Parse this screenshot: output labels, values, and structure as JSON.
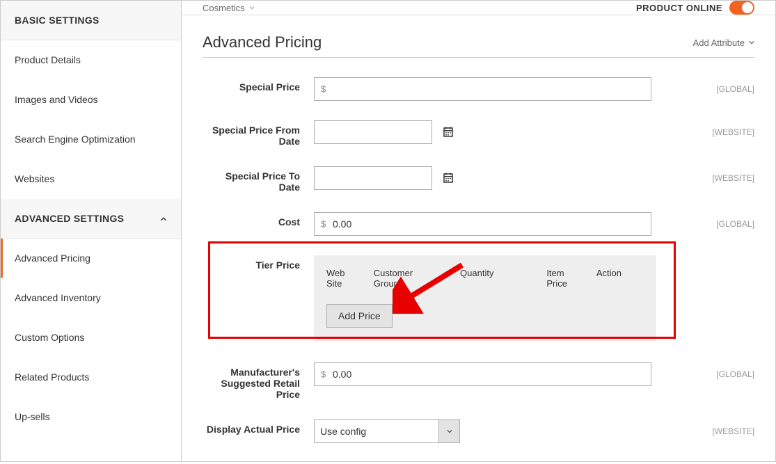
{
  "sidebar": {
    "basic_heading": "BASIC SETTINGS",
    "adv_heading": "ADVANCED SETTINGS",
    "items_basic": [
      {
        "label": "Product Details"
      },
      {
        "label": "Images and Videos"
      },
      {
        "label": "Search Engine Optimization"
      },
      {
        "label": "Websites"
      }
    ],
    "items_adv": [
      {
        "label": "Advanced Pricing"
      },
      {
        "label": "Advanced Inventory"
      },
      {
        "label": "Custom Options"
      },
      {
        "label": "Related Products"
      },
      {
        "label": "Up-sells"
      }
    ]
  },
  "topbar": {
    "breadcrumb": "Cosmetics",
    "status_label": "PRODUCT ONLINE"
  },
  "header": {
    "title": "Advanced Pricing",
    "add_attr": "Add Attribute"
  },
  "form": {
    "special_price": {
      "label": "Special Price",
      "currency": "$",
      "value": "",
      "scope": "[GLOBAL]"
    },
    "special_from": {
      "label": "Special Price From Date",
      "value": "",
      "scope": "[WEBSITE]"
    },
    "special_to": {
      "label": "Special Price To Date",
      "value": "",
      "scope": "[WEBSITE]"
    },
    "cost": {
      "label": "Cost",
      "currency": "$",
      "value": "0.00",
      "scope": "[GLOBAL]"
    },
    "tier": {
      "label": "Tier Price",
      "columns": {
        "website": "Web Site",
        "group": "Customer Group",
        "qty": "Quantity",
        "price": "Item Price",
        "action": "Action"
      },
      "add_btn": "Add Price"
    },
    "msrp": {
      "label": "Manufacturer's Suggested Retail Price",
      "currency": "$",
      "value": "0.00",
      "scope": "[GLOBAL]"
    },
    "display_actual": {
      "label": "Display Actual Price",
      "value": "Use config",
      "scope": "[WEBSITE]"
    }
  }
}
